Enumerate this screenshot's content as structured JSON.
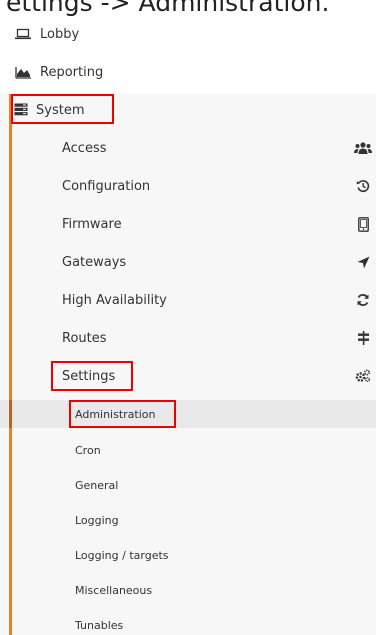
{
  "header": {
    "breadcrumb": "ettings -> Administration."
  },
  "top_items": [
    {
      "label": "Lobby",
      "icon": "laptop-icon"
    },
    {
      "label": "Reporting",
      "icon": "area-chart-icon"
    }
  ],
  "system": {
    "label": "System",
    "icon": "server-icon"
  },
  "sub_items": [
    {
      "label": "Access",
      "icon": "users-icon"
    },
    {
      "label": "Configuration",
      "icon": "history-icon"
    },
    {
      "label": "Firmware",
      "icon": "tablet-icon"
    },
    {
      "label": "Gateways",
      "icon": "location-arrow-icon"
    },
    {
      "label": "High Availability",
      "icon": "refresh-icon"
    },
    {
      "label": "Routes",
      "icon": "map-signs-icon"
    },
    {
      "label": "Settings",
      "icon": "cogs-icon"
    }
  ],
  "settings_children": [
    {
      "label": "Administration",
      "active": true
    },
    {
      "label": "Cron"
    },
    {
      "label": "General"
    },
    {
      "label": "Logging"
    },
    {
      "label": "Logging / targets"
    },
    {
      "label": "Miscellaneous"
    },
    {
      "label": "Tunables"
    }
  ],
  "colors": {
    "accent_bar": "#e2862b",
    "highlight_box": "#e00000",
    "active_bg": "#e9e9e9"
  }
}
